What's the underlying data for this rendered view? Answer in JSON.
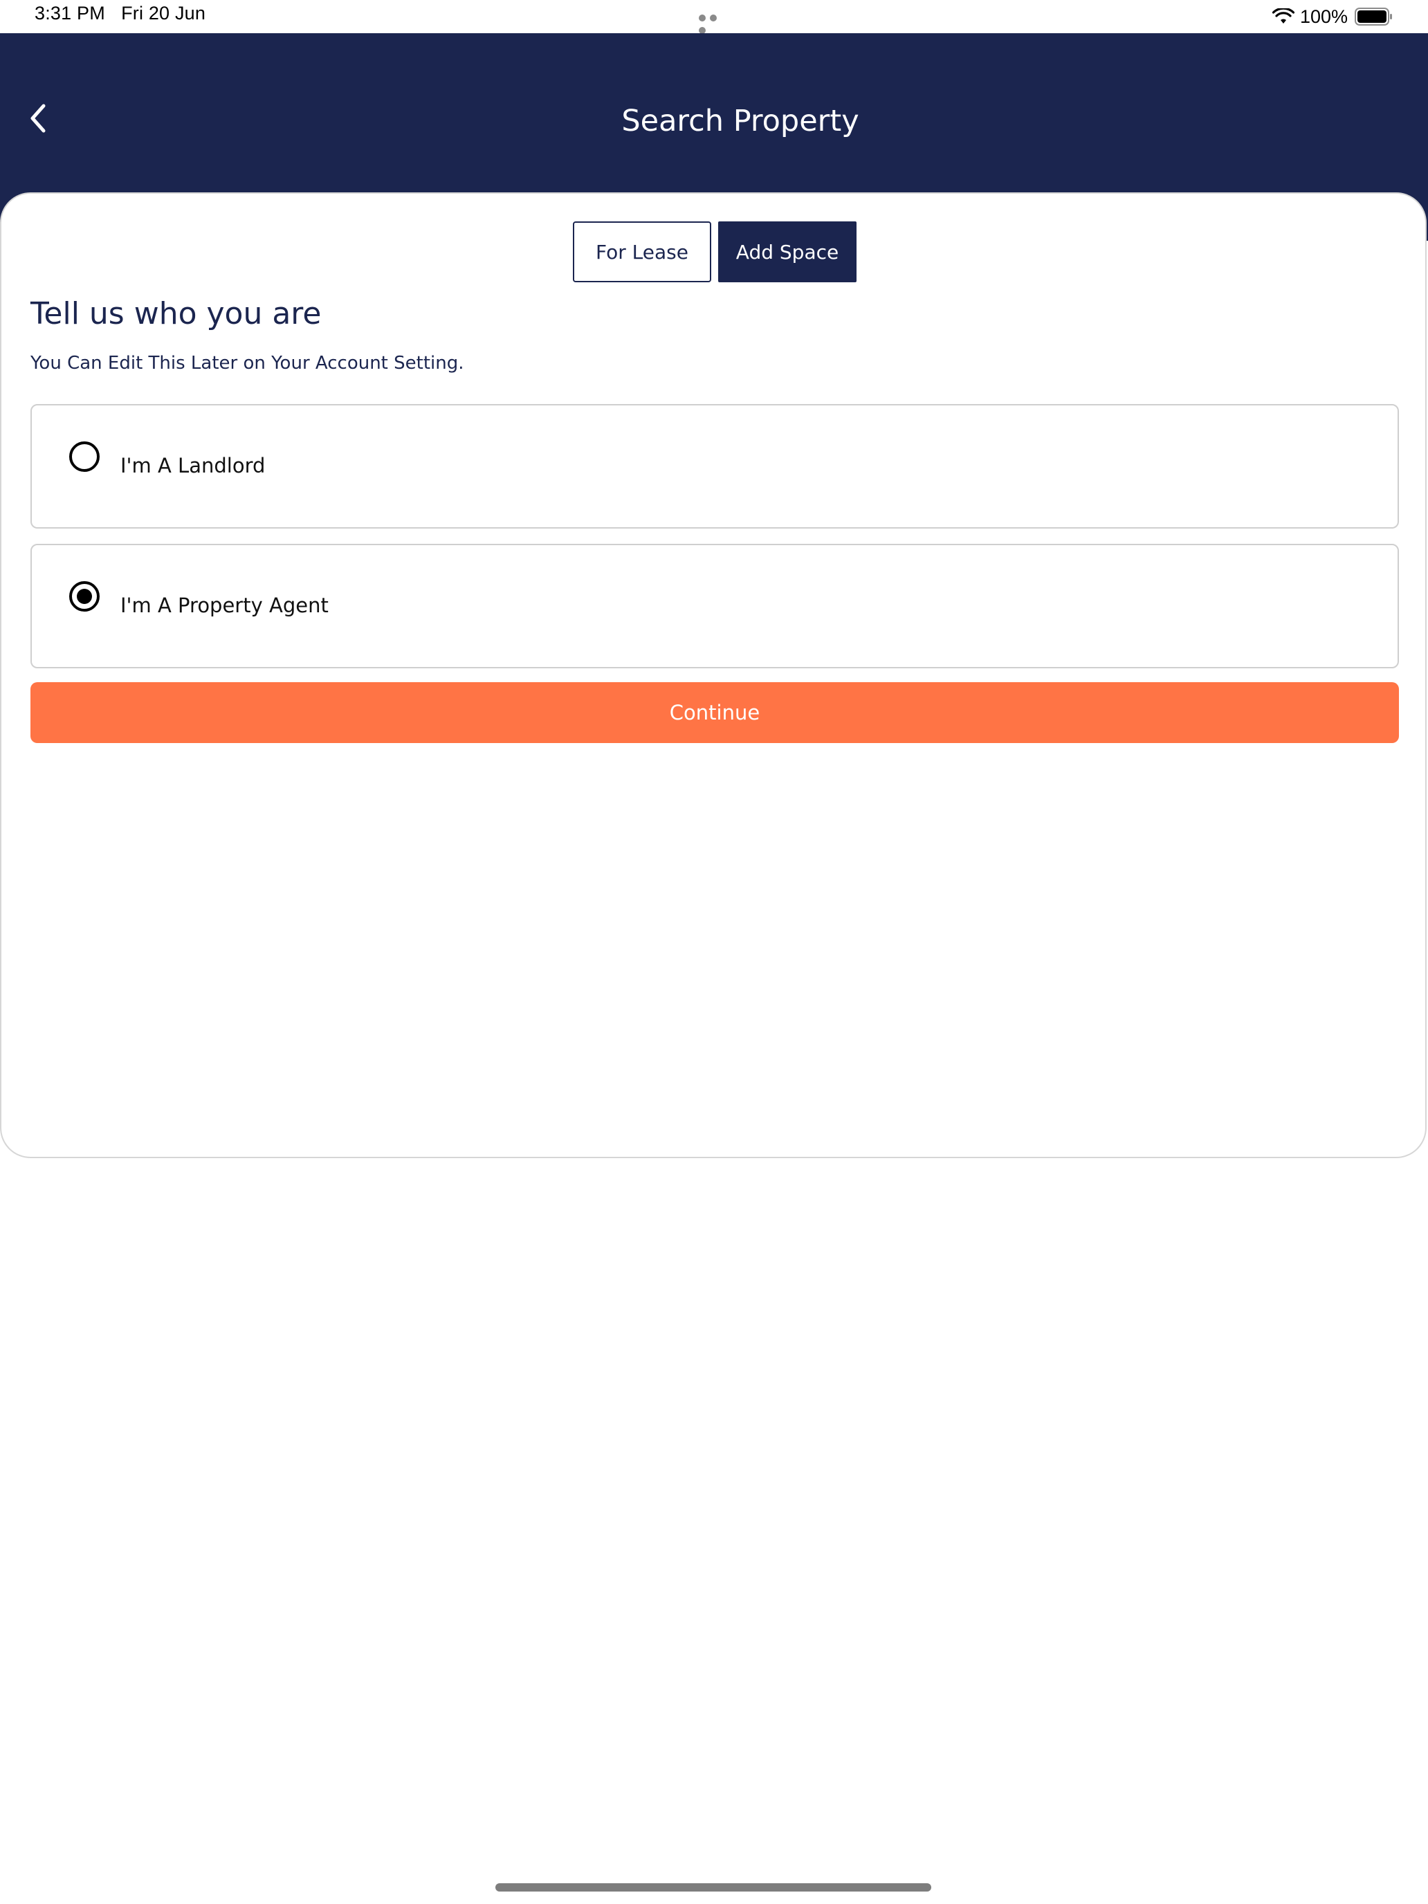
{
  "status_bar": {
    "time": "3:31 PM",
    "date": "Fri 20 Jun",
    "battery": "100%"
  },
  "header": {
    "title": "Search Property",
    "back_icon": "chevron-left-icon",
    "background_color": "#1b254f"
  },
  "tabs": [
    {
      "label": "For Lease",
      "selected": false
    },
    {
      "label": "Add Space",
      "selected": true
    }
  ],
  "main": {
    "heading": "Tell us who you are",
    "subheading": "You Can Edit This Later on Your Account Setting.",
    "options": [
      {
        "label": "I'm A Landlord",
        "selected": false
      },
      {
        "label": "I'm A Property Agent",
        "selected": true
      }
    ],
    "continue_label": "Continue",
    "accent_color": "#ff7445"
  }
}
